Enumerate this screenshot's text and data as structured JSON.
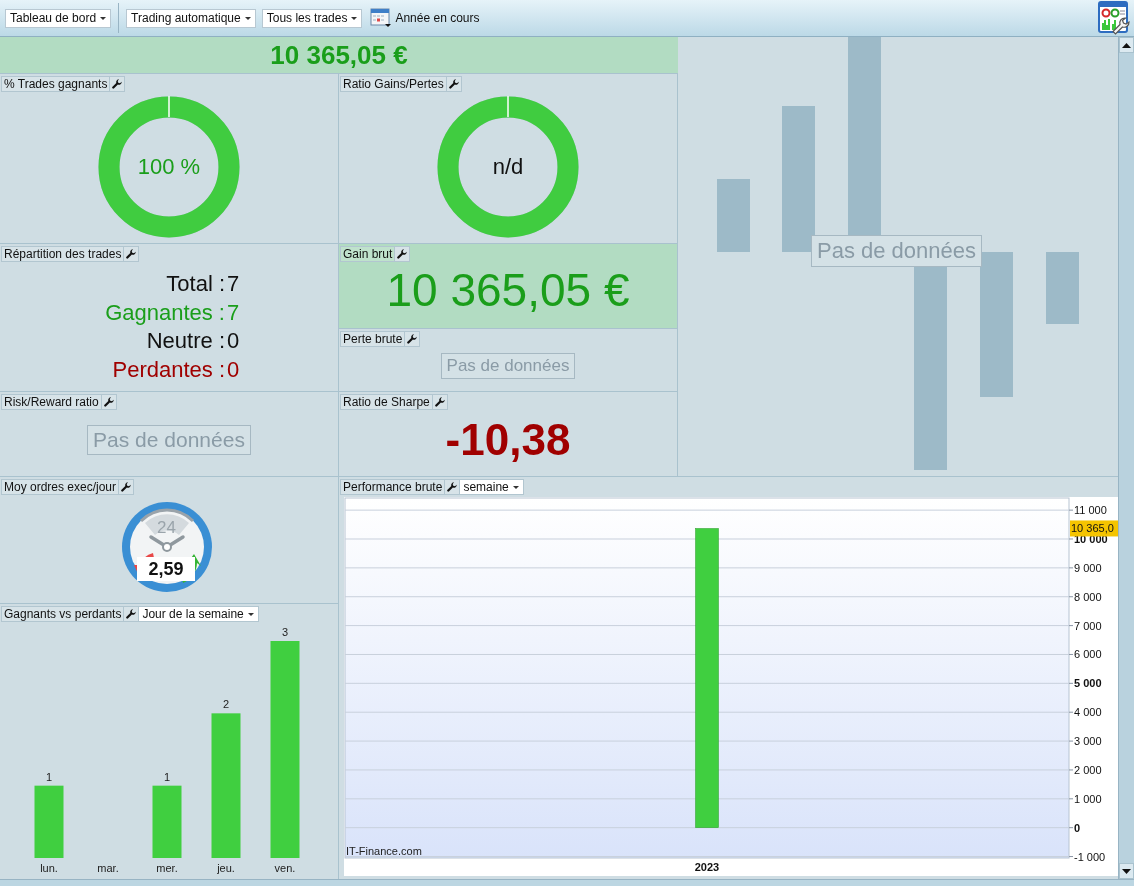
{
  "toolbar": {
    "dropdowns": [
      {
        "label": "Tableau de bord"
      },
      {
        "label": "Trading automatique"
      },
      {
        "label": "Tous les trades"
      }
    ],
    "period": "Année en cours"
  },
  "banner": {
    "value": "10 365,05 €"
  },
  "win_rate": {
    "title": "% Trades gagnants",
    "value": "100 %",
    "level": 1
  },
  "gain_loss_ratio": {
    "title": "Ratio Gains/Pertes",
    "value": "n/d",
    "level": 1
  },
  "trade_breakdown": {
    "title": "Répartition des trades",
    "rows": [
      {
        "label": "Total :",
        "value": "7",
        "color": "#111111"
      },
      {
        "label": "Gagnantes :",
        "value": "7",
        "color": "#1a9e1a"
      },
      {
        "label": "Neutre :",
        "value": "0",
        "color": "#111111"
      },
      {
        "label": "Perdantes :",
        "value": "0",
        "color": "#a00000"
      }
    ]
  },
  "gross_gain": {
    "title": "Gain brut",
    "value": "10 365,05 €"
  },
  "gross_loss": {
    "title": "Perte brute",
    "message": "Pas de données"
  },
  "risk_reward": {
    "title": "Risk/Reward ratio",
    "message": "Pas de données"
  },
  "sharpe": {
    "title": "Ratio de Sharpe",
    "value": "-10,38"
  },
  "history": {
    "message": "Pas de données"
  },
  "orders_per_day": {
    "title": "Moy ordres exec/jour",
    "dial_label": "24",
    "value": "2,59"
  },
  "winners_vs_losers": {
    "title": "Gagnants vs perdants",
    "grouping": "Jour de la semaine",
    "chart_data": {
      "type": "bar",
      "categories": [
        "lun.",
        "mar.",
        "mer.",
        "jeu.",
        "ven."
      ],
      "values": [
        1,
        null,
        1,
        2,
        3
      ],
      "data_labels": true
    }
  },
  "gross_performance": {
    "title": "Performance brute",
    "period": "semaine",
    "credit": "IT-Finance.com",
    "chart_data": {
      "type": "bar",
      "categories": [
        "2023"
      ],
      "values": [
        10365
      ],
      "ylim": [
        -1050,
        11420
      ],
      "grid": true,
      "yticks": [
        {
          "value": 11000,
          "label": "11 000"
        },
        {
          "value": 10000,
          "label": "10 000"
        },
        {
          "value": 9000,
          "label": "9 000"
        },
        {
          "value": 8000,
          "label": "8 000"
        },
        {
          "value": 7000,
          "label": "7 000"
        },
        {
          "value": 6000,
          "label": "6 000"
        },
        {
          "value": 5000,
          "label": "5 000"
        },
        {
          "value": 4000,
          "label": "4 000"
        },
        {
          "value": 3000,
          "label": "3 000"
        },
        {
          "value": 2000,
          "label": "2 000"
        },
        {
          "value": 1000,
          "label": "1 000"
        },
        {
          "value": 0,
          "label": "0"
        },
        {
          "value": -1000,
          "label": "-1 000"
        }
      ],
      "annotations": [
        "10 365,0"
      ]
    }
  }
}
